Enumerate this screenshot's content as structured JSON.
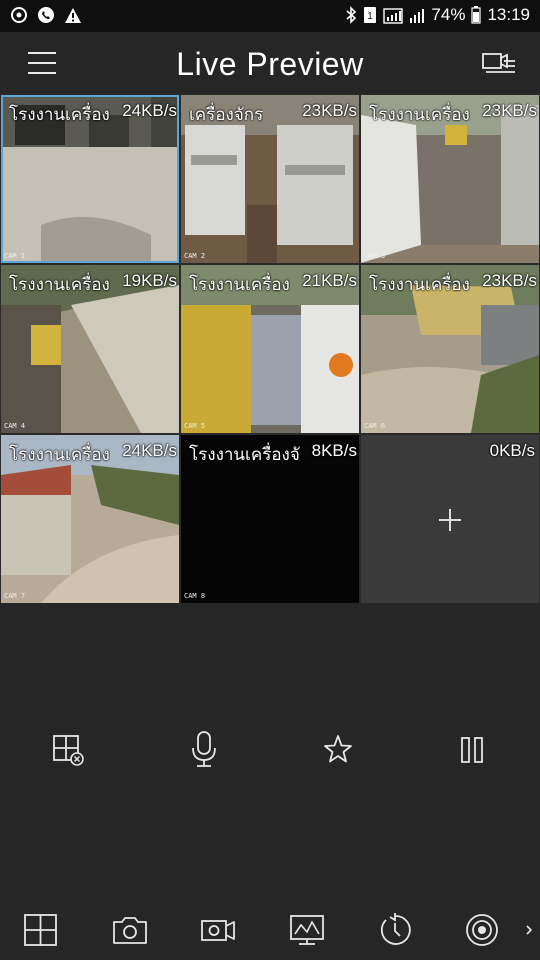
{
  "status_bar": {
    "left_icons": [
      "sync-icon",
      "phone-icon",
      "warning-icon"
    ],
    "right_icons": [
      "bluetooth-icon",
      "sim-icon",
      "network-4g-icon",
      "signal-icon"
    ],
    "battery": "74%",
    "time": "13:19"
  },
  "header": {
    "title": "Live Preview",
    "menu_icon": "hamburger-icon",
    "right_icon": "camera-list-icon"
  },
  "tiles": [
    {
      "label": "โรงงานเครื่อง",
      "rate": "24KB/s",
      "caption": "CAM 1",
      "selected": true
    },
    {
      "label": "เครื่องจักร",
      "rate": "23KB/s",
      "caption": "CAM 2",
      "selected": false
    },
    {
      "label": "โรงงานเครื่อง",
      "rate": "23KB/s",
      "caption": "CAM 3",
      "selected": false
    },
    {
      "label": "โรงงานเครื่อง",
      "rate": "19KB/s",
      "caption": "CAM 4",
      "selected": false
    },
    {
      "label": "โรงงานเครื่อง",
      "rate": "21KB/s",
      "caption": "CAM 5",
      "selected": false
    },
    {
      "label": "โรงงานเครื่อง",
      "rate": "23KB/s",
      "caption": "CAM 6",
      "selected": false
    },
    {
      "label": "โรงงานเครื่อง",
      "rate": "24KB/s",
      "caption": "CAM 7",
      "selected": false
    },
    {
      "label": "โรงงานเครื่องจั",
      "rate": "8KB/s",
      "caption": "CAM 8",
      "selected": false
    },
    {
      "label": "",
      "rate": "0KB/s",
      "caption": "",
      "empty": true
    }
  ],
  "controls": [
    "close-window-icon",
    "microphone-icon",
    "star-icon",
    "pause-icon"
  ],
  "bottom_nav": [
    "grid-layout-icon",
    "snapshot-camera-icon",
    "record-video-icon",
    "playback-monitor-icon",
    "history-icon",
    "ptz-target-icon",
    "more-chevron-icon"
  ],
  "colors": {
    "background": "#262626",
    "status_bar": "#0f0f0f",
    "selected_border": "#5aa6d6",
    "empty_tile": "#3a3a3a"
  }
}
